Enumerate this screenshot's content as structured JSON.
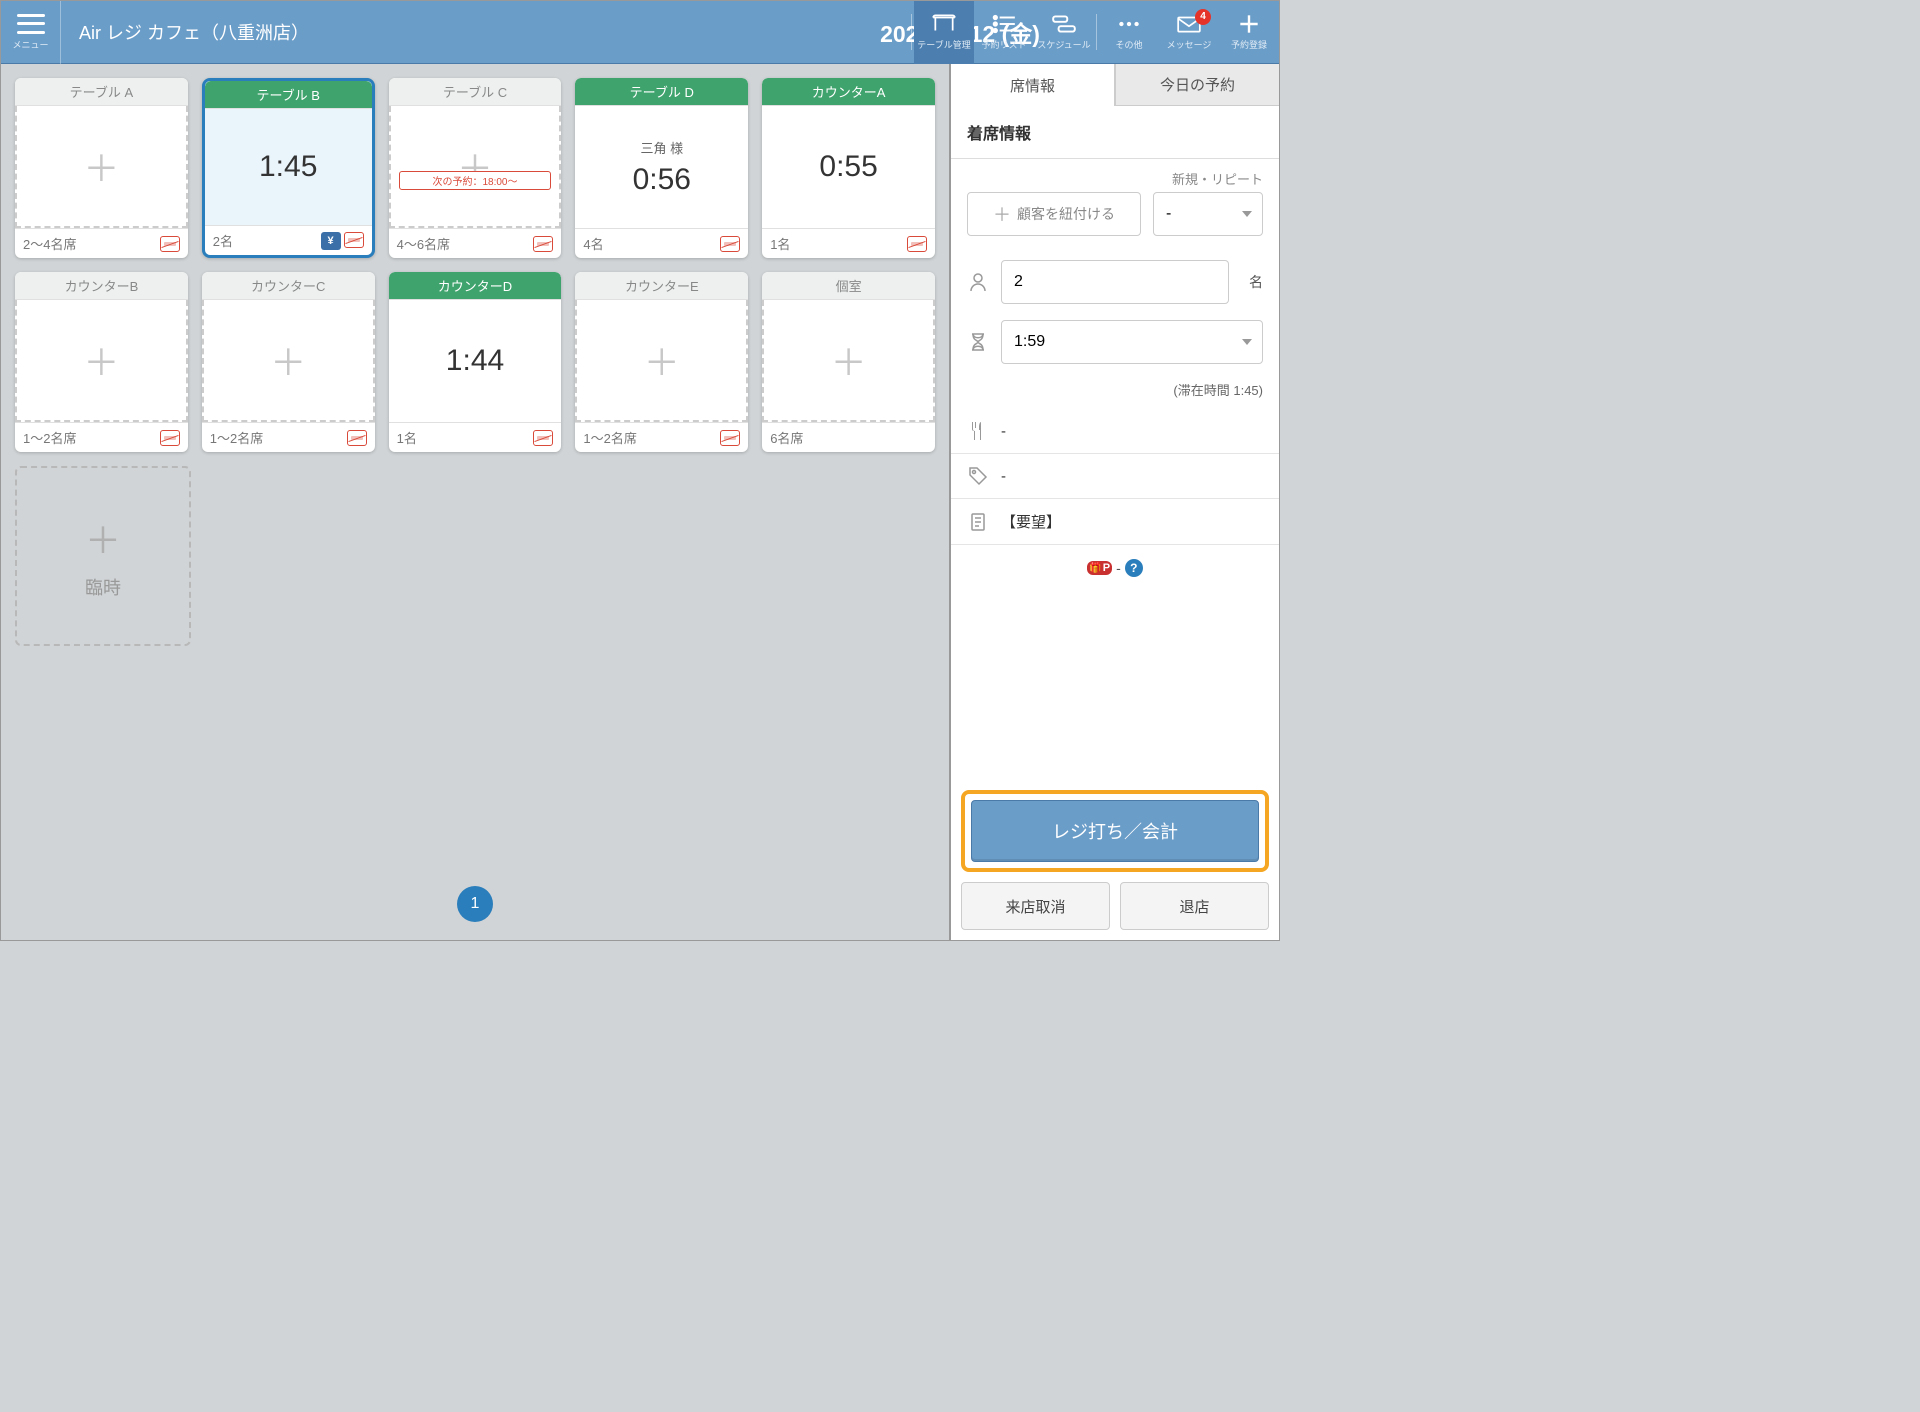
{
  "header": {
    "menu_label": "メニュー",
    "store_name": "Air レジ カフェ（八重洲店）",
    "date": "2023/05/12 (金)",
    "items": [
      {
        "label": "テーブル管理",
        "active": true
      },
      {
        "label": "予約リスト"
      },
      {
        "label": "スケジュール"
      },
      {
        "label": "その他"
      },
      {
        "label": "メッセージ",
        "badge": "4"
      },
      {
        "label": "予約登録"
      }
    ]
  },
  "tables": [
    {
      "name": "テーブル A",
      "capacity": "2～4名席",
      "empty": true
    },
    {
      "name": "テーブル B",
      "capacity": "2名",
      "timer": "1:45",
      "occupied": true,
      "selected": true,
      "yen": true
    },
    {
      "name": "テーブル C",
      "capacity": "4～6名席",
      "empty": true,
      "next": "次の予約：18:00～"
    },
    {
      "name": "テーブル D",
      "capacity": "4名",
      "timer": "0:56",
      "occupied": true,
      "guest": "三角 様"
    },
    {
      "name": "カウンターA",
      "capacity": "1名",
      "timer": "0:55",
      "occupied": true
    },
    {
      "name": "カウンターB",
      "capacity": "1～2名席",
      "empty": true
    },
    {
      "name": "カウンターC",
      "capacity": "1～2名席",
      "empty": true
    },
    {
      "name": "カウンターD",
      "capacity": "1名",
      "timer": "1:44",
      "occupied": true
    },
    {
      "name": "カウンターE",
      "capacity": "1～2名席",
      "empty": true
    },
    {
      "name": "個室",
      "capacity": "6名席",
      "empty": true,
      "nosmoke": false
    }
  ],
  "temp_label": "臨時",
  "pager": "1",
  "sidebar": {
    "tabs": [
      "席情報",
      "今日の予約"
    ],
    "section": "着席情報",
    "repeat_label": "新規・リピート",
    "link_customer": "顧客を紐付ける",
    "repeat_value": "-",
    "guests": "2",
    "guests_suffix": "名",
    "time_value": "1:59",
    "stay_note": "(滞在時間 1:45)",
    "course_value": "-",
    "tag_value": "-",
    "request_label": "【要望】",
    "points_text": "-",
    "primary_btn": "レジ打ち／会計",
    "cancel_btn": "来店取消",
    "leave_btn": "退店"
  }
}
